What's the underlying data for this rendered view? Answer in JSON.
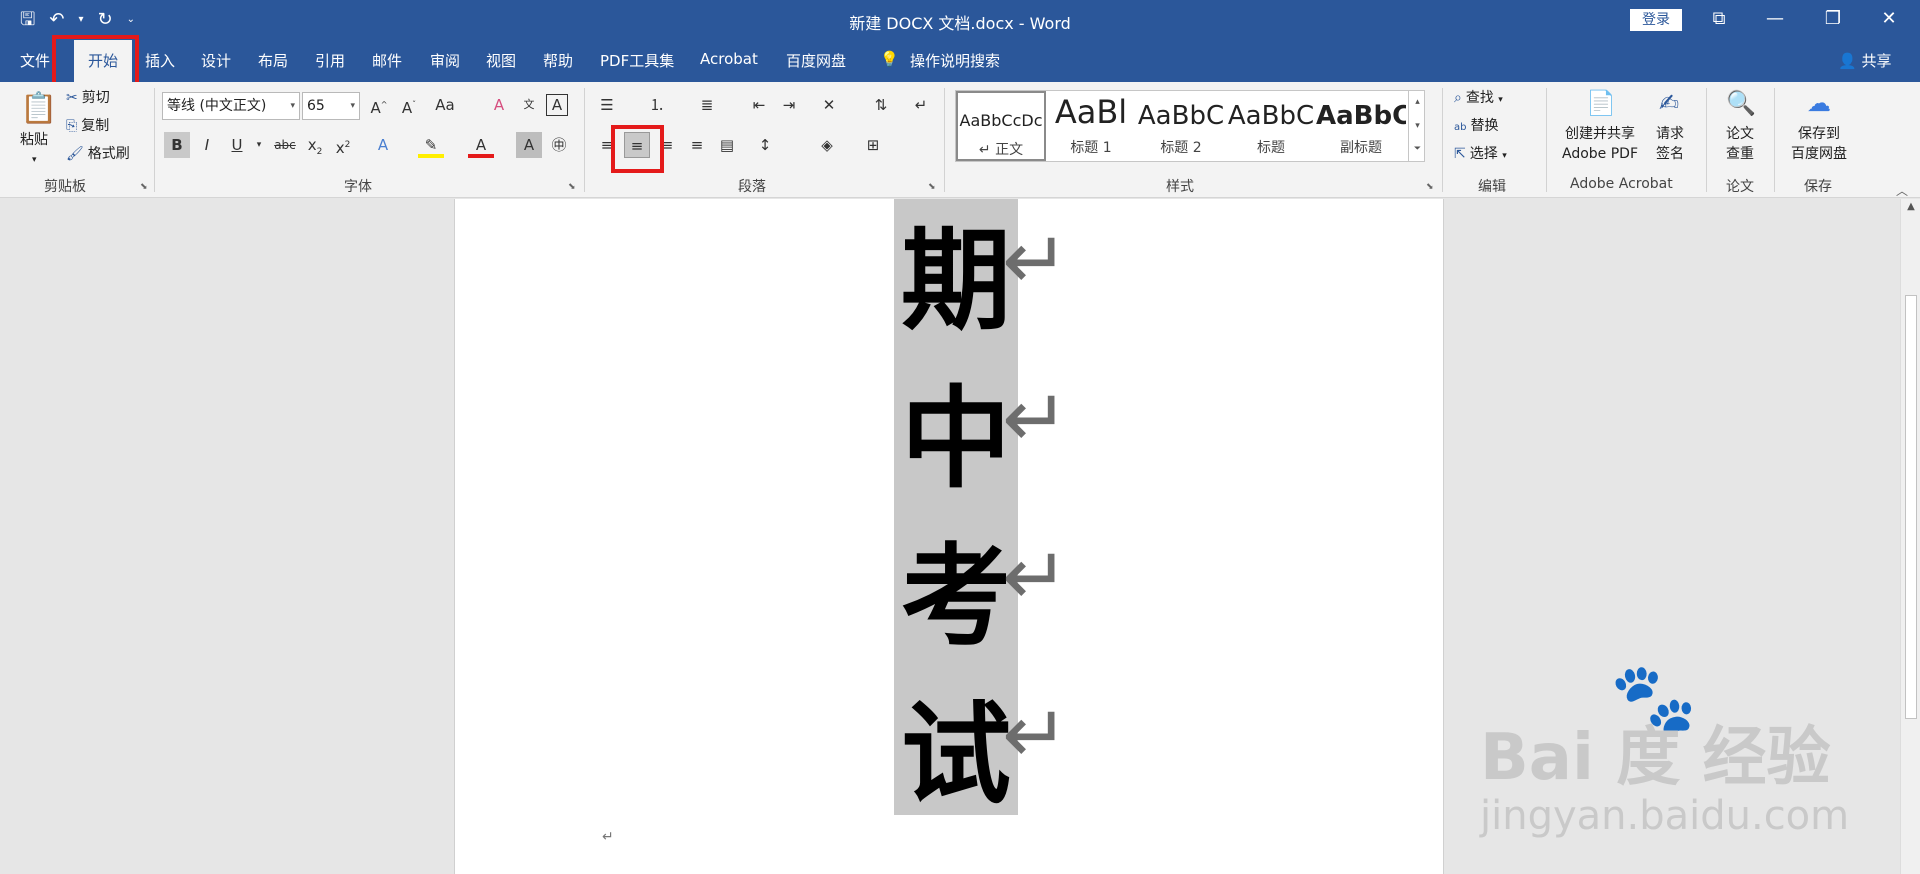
{
  "window": {
    "title": "新建 DOCX 文档.docx  -  Word",
    "login_label": "登录",
    "controls": [
      "⧉",
      "—",
      "❐",
      "✕"
    ]
  },
  "qat": {
    "save": "🖫",
    "undo": "↶",
    "redo": "↻",
    "more": "⌄"
  },
  "tabs": [
    "文件",
    "开始",
    "插入",
    "设计",
    "布局",
    "引用",
    "邮件",
    "审阅",
    "视图",
    "帮助",
    "PDF工具集",
    "Acrobat",
    "百度网盘",
    "操作说明搜索"
  ],
  "active_tab": "开始",
  "share_label": "共享",
  "ribbon": {
    "clipboard": {
      "paste": "粘贴",
      "cut": "剪切",
      "copy": "复制",
      "format_painter": "格式刷",
      "label": "剪贴板"
    },
    "font": {
      "font_name": "等线 (中文正文)",
      "font_size": "65",
      "label": "字体"
    },
    "paragraph": {
      "label": "段落"
    },
    "styles": {
      "label": "样式",
      "items": [
        {
          "preview": "AaBbCcDc",
          "name": "↵ 正文"
        },
        {
          "preview": "AaBl",
          "name": "标题 1"
        },
        {
          "preview": "AaBbC",
          "name": "标题 2"
        },
        {
          "preview": "AaBbC",
          "name": "标题"
        },
        {
          "preview": "AaBbC",
          "name": "副标题"
        }
      ]
    },
    "editing": {
      "find": "查找",
      "replace": "替换",
      "select": "选择",
      "label": "编辑"
    },
    "acrobat": {
      "create_line1": "创建并共享",
      "create_line2": "Adobe PDF",
      "sign_line1": "请求",
      "sign_line2": "签名",
      "label": "Adobe Acrobat"
    },
    "thesis": {
      "line1": "论文",
      "line2": "查重",
      "label": "论文"
    },
    "save": {
      "line1": "保存到",
      "line2": "百度网盘",
      "label": "保存"
    }
  },
  "document": {
    "characters": [
      "期",
      "中",
      "考",
      "试"
    ],
    "paragraph_mark": "↵"
  },
  "watermark": {
    "brand": "Bai 度 经验",
    "url": "jingyan.baidu.com"
  },
  "colors": {
    "accent": "#2b579a",
    "highlight_box": "#e41a1a",
    "selection": "#c8c8c8"
  }
}
